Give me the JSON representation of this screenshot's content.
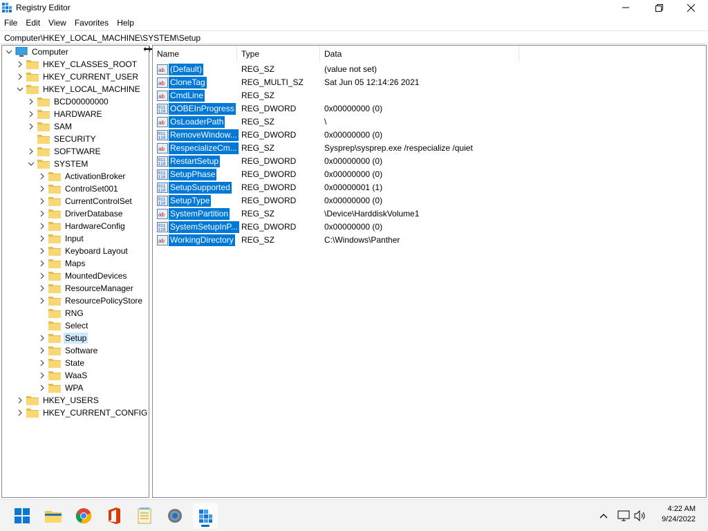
{
  "window": {
    "title": "Registry Editor",
    "icon": "registry-editor-icon"
  },
  "menu": [
    "File",
    "Edit",
    "View",
    "Favorites",
    "Help"
  ],
  "address": "Computer\\HKEY_LOCAL_MACHINE\\SYSTEM\\Setup",
  "tree": {
    "root": "Computer",
    "hives": [
      "HKEY_CLASSES_ROOT",
      "HKEY_CURRENT_USER",
      "HKEY_LOCAL_MACHINE"
    ],
    "hklm_children": [
      "BCD00000000",
      "HARDWARE",
      "SAM",
      "SECURITY",
      "SOFTWARE",
      "SYSTEM"
    ],
    "system_children": [
      "ActivationBroker",
      "ControlSet001",
      "CurrentControlSet",
      "DriverDatabase",
      "HardwareConfig",
      "Input",
      "Keyboard Layout",
      "Maps",
      "MountedDevices",
      "ResourceManager",
      "ResourcePolicyStore",
      "RNG",
      "Select",
      "Setup",
      "Software",
      "State",
      "WaaS",
      "WPA"
    ],
    "other_hives": [
      "HKEY_USERS",
      "HKEY_CURRENT_CONFIG"
    ],
    "selected": "Setup"
  },
  "list": {
    "columns": [
      "Name",
      "Type",
      "Data"
    ],
    "rows": [
      {
        "name": "(Default)",
        "type": "REG_SZ",
        "data": "(value not set)",
        "icon": "string-value-icon"
      },
      {
        "name": "CloneTag",
        "type": "REG_MULTI_SZ",
        "data": "Sat Jun 05 12:14:26 2021",
        "icon": "string-value-icon"
      },
      {
        "name": "CmdLine",
        "type": "REG_SZ",
        "data": "",
        "icon": "string-value-icon"
      },
      {
        "name": "OOBEInProgress",
        "type": "REG_DWORD",
        "data": "0x00000000 (0)",
        "icon": "binary-value-icon"
      },
      {
        "name": "OsLoaderPath",
        "type": "REG_SZ",
        "data": "\\",
        "icon": "string-value-icon"
      },
      {
        "name": "RemoveWindow...",
        "type": "REG_DWORD",
        "data": "0x00000000 (0)",
        "icon": "binary-value-icon"
      },
      {
        "name": "RespecializeCm...",
        "type": "REG_SZ",
        "data": "Sysprep\\sysprep.exe /respecialize /quiet",
        "icon": "string-value-icon"
      },
      {
        "name": "RestartSetup",
        "type": "REG_DWORD",
        "data": "0x00000000 (0)",
        "icon": "binary-value-icon"
      },
      {
        "name": "SetupPhase",
        "type": "REG_DWORD",
        "data": "0x00000000 (0)",
        "icon": "binary-value-icon"
      },
      {
        "name": "SetupSupported",
        "type": "REG_DWORD",
        "data": "0x00000001 (1)",
        "icon": "binary-value-icon"
      },
      {
        "name": "SetupType",
        "type": "REG_DWORD",
        "data": "0x00000000 (0)",
        "icon": "binary-value-icon"
      },
      {
        "name": "SystemPartition",
        "type": "REG_SZ",
        "data": "\\Device\\HarddiskVolume1",
        "icon": "string-value-icon"
      },
      {
        "name": "SystemSetupInP...",
        "type": "REG_DWORD",
        "data": "0x00000000 (0)",
        "icon": "binary-value-icon"
      },
      {
        "name": "WorkingDirectory",
        "type": "REG_SZ",
        "data": "C:\\Windows\\Panther",
        "icon": "string-value-icon"
      }
    ]
  },
  "taskbar": {
    "apps": [
      "start-icon",
      "file-explorer-icon",
      "chrome-icon",
      "office-icon",
      "notepad-icon",
      "settings-icon",
      "registry-editor-icon"
    ],
    "time": "4:22 AM",
    "date": "9/24/2022"
  },
  "colors": {
    "selection": "#0078d7",
    "tree_selection": "#cce8ff",
    "folder": "#f8d775"
  }
}
